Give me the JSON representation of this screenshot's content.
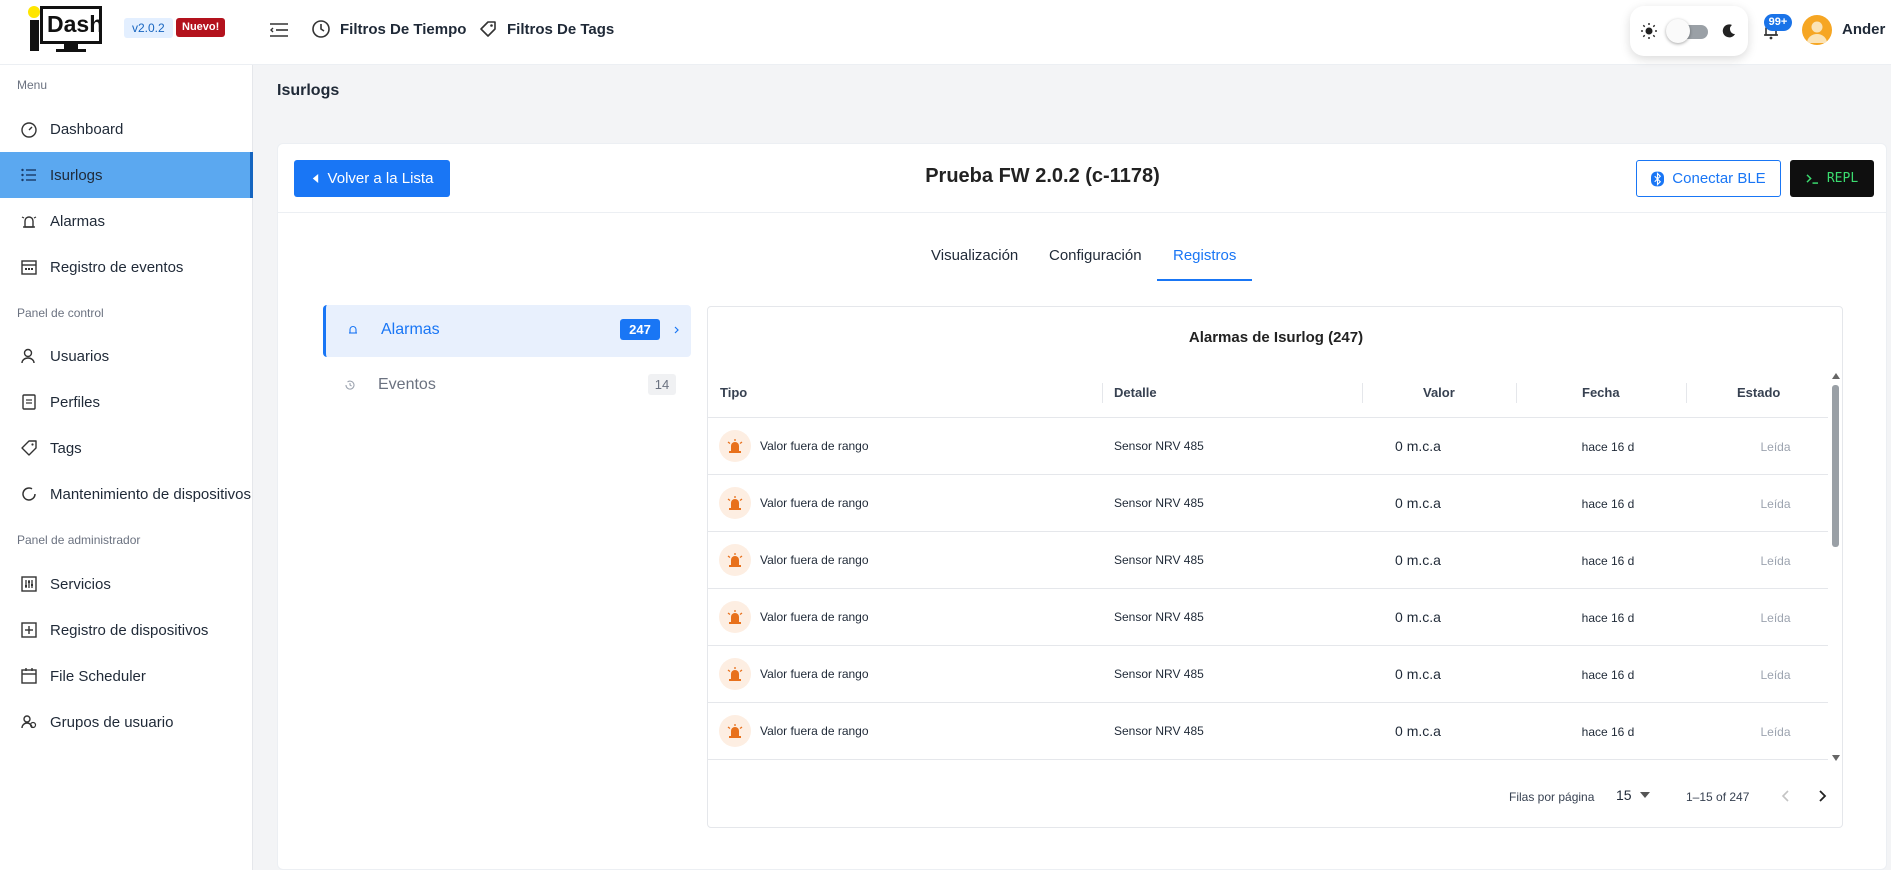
{
  "app": {
    "logo_text": "Dash",
    "version": "v2.0.2",
    "new_badge": "Nuevo!"
  },
  "topbar": {
    "time_filters": "Filtros De Tiempo",
    "tag_filters": "Filtros De Tags",
    "notifications_count": "99+",
    "user_name": "Ander"
  },
  "sidebar": {
    "menu_label": "Menu",
    "menu_items": [
      {
        "label": "Dashboard",
        "icon": "dashboard-icon"
      },
      {
        "label": "Isurlogs",
        "icon": "list-icon",
        "active": true
      },
      {
        "label": "Alarmas",
        "icon": "alarm-icon"
      },
      {
        "label": "Registro de eventos",
        "icon": "calendar-icon"
      }
    ],
    "control_label": "Panel de control",
    "control_items": [
      {
        "label": "Usuarios",
        "icon": "user-icon"
      },
      {
        "label": "Perfiles",
        "icon": "profile-icon"
      },
      {
        "label": "Tags",
        "icon": "tag-icon"
      },
      {
        "label": "Mantenimiento de dispositivos",
        "icon": "refresh-icon"
      }
    ],
    "admin_label": "Panel de administrador",
    "admin_items": [
      {
        "label": "Servicios",
        "icon": "sliders-icon"
      },
      {
        "label": "Registro de dispositivos",
        "icon": "add-box-icon"
      },
      {
        "label": "File Scheduler",
        "icon": "calendar-icon"
      },
      {
        "label": "Grupos de usuario",
        "icon": "group-icon"
      }
    ]
  },
  "page": {
    "title": "Isurlogs",
    "back_button": "Volver a la Lista",
    "device_title": "Prueba FW 2.0.2 (c-1178)",
    "ble_button": "Conectar BLE",
    "repl_button": "REPL"
  },
  "tabs": [
    {
      "label": "Visualización"
    },
    {
      "label": "Configuración"
    },
    {
      "label": "Registros",
      "active": true
    }
  ],
  "side_menu": [
    {
      "label": "Alarmas",
      "count": "247",
      "active": true
    },
    {
      "label": "Eventos",
      "count": "14"
    }
  ],
  "table": {
    "title": "Alarmas de Isurlog (247)",
    "columns": [
      "Tipo",
      "Detalle",
      "Valor",
      "Fecha",
      "Estado"
    ],
    "rows": [
      {
        "type": "Valor fuera de rango",
        "detail": "Sensor NRV 485",
        "value": "0 m.c.a",
        "date": "hace 16 d",
        "state": "Leída"
      },
      {
        "type": "Valor fuera de rango",
        "detail": "Sensor NRV 485",
        "value": "0 m.c.a",
        "date": "hace 16 d",
        "state": "Leída"
      },
      {
        "type": "Valor fuera de rango",
        "detail": "Sensor NRV 485",
        "value": "0 m.c.a",
        "date": "hace 16 d",
        "state": "Leída"
      },
      {
        "type": "Valor fuera de rango",
        "detail": "Sensor NRV 485",
        "value": "0 m.c.a",
        "date": "hace 16 d",
        "state": "Leída"
      },
      {
        "type": "Valor fuera de rango",
        "detail": "Sensor NRV 485",
        "value": "0 m.c.a",
        "date": "hace 16 d",
        "state": "Leída"
      },
      {
        "type": "Valor fuera de rango",
        "detail": "Sensor NRV 485",
        "value": "0 m.c.a",
        "date": "hace 16 d",
        "state": "Leída"
      }
    ],
    "pagination": {
      "rows_per_page_label": "Filas por página",
      "rows_per_page": "15",
      "range": "1–15 of 247"
    }
  },
  "colors": {
    "primary": "#1976f5",
    "sidebar_active": "#5ba8f0",
    "alarm_icon": "#e8711c",
    "new_badge": "#b3121d"
  }
}
